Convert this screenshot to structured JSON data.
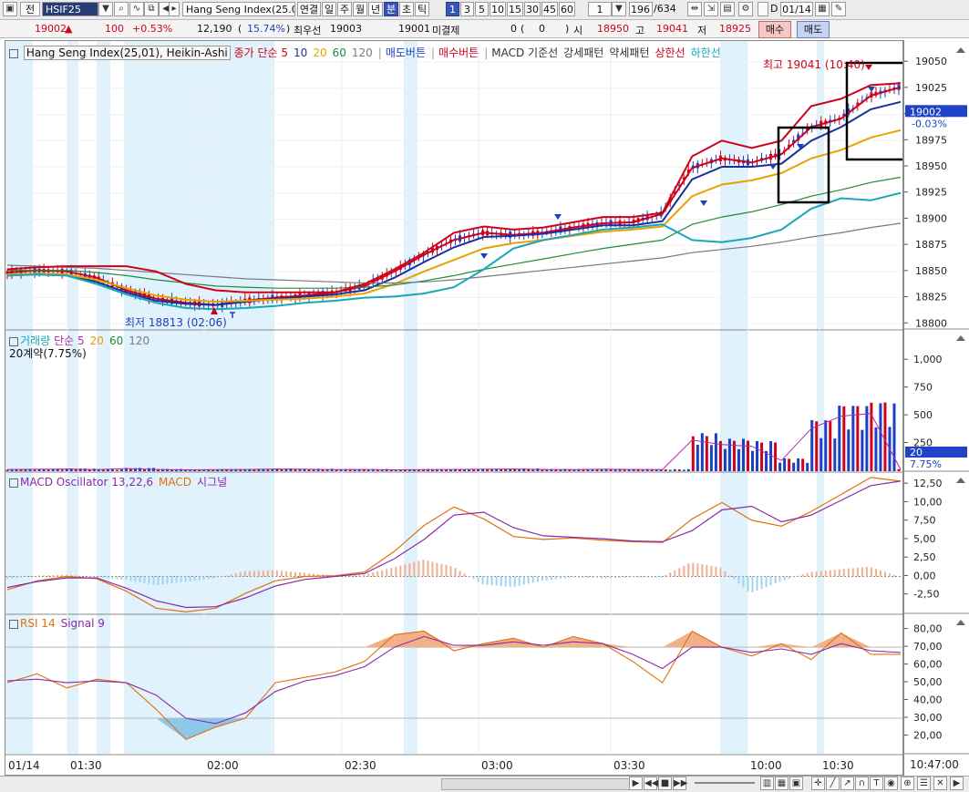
{
  "toolbar": {
    "tab_label": "전",
    "code": "HSIF25",
    "symbol_name": "Hang Seng Index(25.0",
    "periods": [
      "연결",
      "일",
      "주",
      "월",
      "년",
      "분",
      "초",
      "틱"
    ],
    "active_period": "분",
    "intervals": [
      "1",
      "3",
      "5",
      "10",
      "15",
      "30",
      "45",
      "60"
    ],
    "active_interval": "1",
    "interval_select": "1",
    "count": "196",
    "total": "/634",
    "checkbox_label": "D",
    "date": "01/14"
  },
  "quote": {
    "price": "19002",
    "change_arrow": "▲",
    "change": "100",
    "change_pct": "+0.53%",
    "volume": "12,190",
    "vol_ratio": "15.74%",
    "best_label": "최우선",
    "best_ask": "19003",
    "best_bid": "19001",
    "open_int_label": "미결제",
    "open_int": "0",
    "oi_change": "0",
    "open_label": "시",
    "open": "18950",
    "high_label": "고",
    "high": "19041",
    "low_label": "저",
    "low": "18925",
    "buy_label": "매수",
    "sell_label": "매도"
  },
  "legend": {
    "price_title": "Hang Seng Index(25,01), Heikin-Ashi",
    "ma_label": "종가 단순 5",
    "ma_periods": [
      "10",
      "20",
      "60",
      "120"
    ],
    "signals": [
      "매도버튼",
      "매수버튼"
    ],
    "overlay_items": [
      "MACD 기준선",
      "강세패턴",
      "약세패턴"
    ],
    "upper_band": "상한선",
    "lower_band": "하한선",
    "vol_title": "거래량",
    "vol_ma_label": "단순 5",
    "vol_ma_periods": [
      "20",
      "60",
      "120"
    ],
    "vol_sub": "20계약(7.75%)",
    "macd_title": "MACD Oscillator 13,22,6",
    "macd_line": "MACD",
    "macd_signal": "시그널",
    "rsi_title": "RSI 14",
    "rsi_signal": "Signal 9"
  },
  "annotations": {
    "high_text": "최고 19041 (10:40)",
    "low_text": "최저 18813 (02:06)"
  },
  "axes": {
    "price_ticks": [
      "19050",
      "19025",
      "19000",
      "18975",
      "18950",
      "18925",
      "18900",
      "18875",
      "18850",
      "18825",
      "18800"
    ],
    "current_price": "19002",
    "current_pct": "-0.03%",
    "volume_ticks": [
      "1,000",
      "750",
      "500",
      "250"
    ],
    "volume_current": "20",
    "volume_pct": "7.75%",
    "macd_ticks": [
      "12,50",
      "10,00",
      "7,50",
      "5,00",
      "2,50",
      "0,00",
      "-2,50"
    ],
    "rsi_ticks": [
      "80,00",
      "70,00",
      "60,00",
      "50,00",
      "40,00",
      "30,00",
      "20,00"
    ],
    "time_labels": [
      "01/14",
      "01:30",
      "02:00",
      "02:30",
      "03:00",
      "03:30",
      "10:00",
      "10:30"
    ],
    "clock": "10:47:00"
  },
  "colors": {
    "up": "#d0021b",
    "down": "#1c3fc4",
    "ma5": "#d0021b",
    "ma10": "#1a2f9e",
    "ma20": "#e8a200",
    "ma60": "#1e8c3a",
    "ma120": "#7a7a7a",
    "band": "#17a7b8",
    "highlight": "#e0f2fb",
    "macd": "#e07010",
    "macd_signal": "#8a2aa8",
    "rsi": "#e07010",
    "rsi_signal": "#8a2aa8"
  },
  "chart_data": [
    {
      "type": "line",
      "title": "Hang Seng Index(25,01), Heikin-Ashi",
      "ylim": [
        18795,
        19058
      ],
      "x_labels": [
        "01/14",
        "01:30",
        "02:00",
        "02:30",
        "03:00",
        "03:30",
        "10:00",
        "10:30"
      ],
      "series": [
        {
          "name": "종가 단순 5",
          "values": [
            18849,
            18851,
            18850,
            18844,
            18832,
            18824,
            18820,
            18818,
            18822,
            18825,
            18827,
            18830,
            18836,
            18850,
            18866,
            18880,
            18887,
            18885,
            18887,
            18892,
            18896,
            18897,
            18905,
            18949,
            18958,
            18954,
            18962,
            18988,
            18996,
            19018,
            19026
          ]
        },
        {
          "name": "10",
          "values": [
            18846,
            18848,
            18847,
            18840,
            18830,
            18822,
            18819,
            18818,
            18821,
            18824,
            18826,
            18828,
            18832,
            18844,
            18859,
            18873,
            18883,
            18884,
            18886,
            18890,
            18894,
            18894,
            18898,
            18938,
            18950,
            18950,
            18953,
            18975,
            18988,
            19005,
            19012
          ]
        },
        {
          "name": "20",
          "values": [
            18847,
            18848,
            18847,
            18842,
            18834,
            18827,
            18823,
            18821,
            18822,
            18823,
            18824,
            18826,
            18829,
            18838,
            18850,
            18861,
            18872,
            18877,
            18880,
            18884,
            18888,
            18890,
            18893,
            18922,
            18933,
            18937,
            18944,
            18958,
            18966,
            18978,
            18985
          ]
        },
        {
          "name": "60",
          "values": [
            18851,
            18851,
            18851,
            18849,
            18846,
            18842,
            18839,
            18836,
            18835,
            18834,
            18834,
            18834,
            18835,
            18837,
            18841,
            18846,
            18852,
            18857,
            18862,
            18867,
            18872,
            18876,
            18880,
            18895,
            18902,
            18907,
            18914,
            18922,
            18928,
            18935,
            18940
          ]
        },
        {
          "name": "120",
          "values": [
            18856,
            18855,
            18854,
            18853,
            18851,
            18849,
            18847,
            18845,
            18843,
            18842,
            18841,
            18840,
            18839,
            18839,
            18840,
            18842,
            18845,
            18848,
            18851,
            18854,
            18857,
            18860,
            18863,
            18868,
            18871,
            18874,
            18878,
            18883,
            18887,
            18892,
            18896
          ]
        },
        {
          "name": "상한선",
          "values": [
            18852,
            18854,
            18855,
            18855,
            18855,
            18850,
            18838,
            18832,
            18830,
            18830,
            18830,
            18830,
            18838,
            18852,
            18868,
            18887,
            18893,
            18890,
            18892,
            18897,
            18902,
            18902,
            18906,
            18960,
            18975,
            18968,
            18975,
            19008,
            19015,
            19028,
            19030
          ]
        },
        {
          "name": "하한선",
          "values": [
            18846,
            18847,
            18846,
            18838,
            18828,
            18820,
            18815,
            18814,
            18815,
            18817,
            18820,
            18822,
            18825,
            18826,
            18829,
            18835,
            18852,
            18872,
            18880,
            18885,
            18890,
            18892,
            18895,
            18880,
            18878,
            18882,
            18890,
            18910,
            18920,
            18918,
            18925
          ]
        }
      ]
    },
    {
      "type": "bar",
      "title": "거래량",
      "ylim": [
        0,
        1100
      ],
      "values": [
        20,
        22,
        25,
        18,
        30,
        20,
        15,
        18,
        20,
        25,
        22,
        18,
        20,
        15,
        18,
        20,
        22,
        25,
        20,
        18,
        22,
        20,
        18,
        350,
        300,
        280,
        120,
        480,
        620,
        650,
        20
      ]
    },
    {
      "type": "line",
      "title": "MACD Oscillator 13,22,6",
      "ylim": [
        -5,
        14
      ],
      "series": [
        {
          "name": "MACD",
          "values": [
            -1.8,
            -0.6,
            0.0,
            -0.3,
            -2.0,
            -4.3,
            -4.8,
            -4.3,
            -2.3,
            -0.6,
            0.0,
            0.1,
            0.6,
            3.4,
            6.9,
            9.4,
            7.8,
            5.4,
            5.0,
            5.2,
            4.9,
            4.7,
            4.6,
            7.8,
            10.0,
            7.6,
            6.8,
            8.8,
            11.1,
            13.4,
            12.9
          ]
        },
        {
          "name": "시그널",
          "values": [
            -1.5,
            -0.7,
            -0.2,
            -0.2,
            -1.6,
            -3.3,
            -4.2,
            -4.1,
            -2.9,
            -1.3,
            -0.4,
            0.0,
            0.4,
            2.4,
            5.0,
            8.3,
            8.7,
            6.6,
            5.5,
            5.3,
            5.1,
            4.8,
            4.7,
            6.2,
            9.0,
            9.5,
            7.4,
            8.3,
            10.3,
            12.3,
            12.9
          ]
        }
      ]
    },
    {
      "type": "line",
      "title": "RSI 14",
      "ylim": [
        10,
        88
      ],
      "series": [
        {
          "name": "RSI 14",
          "values": [
            50,
            55,
            47,
            52,
            50,
            35,
            18,
            25,
            30,
            50,
            53,
            56,
            62,
            77,
            79,
            68,
            72,
            75,
            70,
            76,
            72,
            62,
            50,
            79,
            70,
            65,
            72,
            63,
            78,
            66,
            66
          ]
        },
        {
          "name": "Signal 9",
          "values": [
            51,
            52,
            50,
            51,
            50,
            43,
            30,
            27,
            33,
            45,
            51,
            54,
            59,
            70,
            76,
            71,
            71,
            73,
            71,
            73,
            72,
            66,
            58,
            70,
            70,
            67,
            69,
            66,
            72,
            68,
            67
          ]
        }
      ]
    }
  ]
}
